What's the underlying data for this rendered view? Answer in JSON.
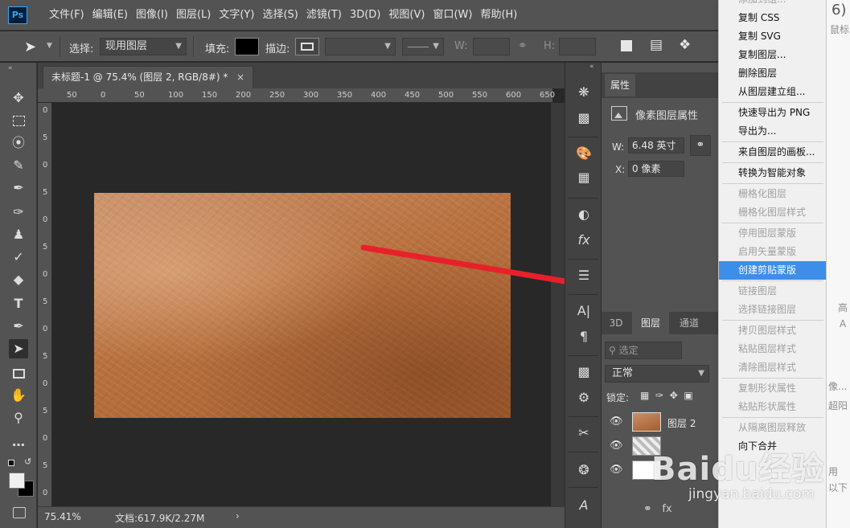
{
  "app": {
    "logo": "Ps"
  },
  "menu": [
    "文件(F)",
    "编辑(E)",
    "图像(I)",
    "图层(L)",
    "文字(Y)",
    "选择(S)",
    "滤镜(T)",
    "3D(D)",
    "视图(V)",
    "窗口(W)",
    "帮助(H)"
  ],
  "options": {
    "select_label": "选择:",
    "select_value": "现用图层",
    "fill_label": "填充:",
    "stroke_label": "描边:",
    "w_label": "W:",
    "h_label": "H:"
  },
  "document": {
    "tab_title": "未标题-1 @ 75.4% (图层 2, RGB/8#) *",
    "ruler_h": [
      "50",
      "0",
      "50",
      "100",
      "150",
      "200",
      "250",
      "300",
      "350",
      "400",
      "450",
      "500",
      "550",
      "600",
      "650"
    ],
    "ruler_v": [
      "0",
      "5",
      "0",
      "5",
      "0",
      "5",
      "0",
      "5",
      "0",
      "5",
      "0",
      "5",
      "0",
      "5",
      "0"
    ]
  },
  "status": {
    "zoom": "75.41%",
    "doc": "文档:617.9K/2.27M",
    "arrow": "›"
  },
  "properties": {
    "tab": "属性",
    "title": "像素图层属性",
    "w_label": "W:",
    "w_value": "6.48 英寸",
    "x_label": "X:",
    "x_value": "0 像素"
  },
  "layers": {
    "tabs": [
      "3D",
      "图层",
      "通道"
    ],
    "filter_placeholder": "选定",
    "blend_mode": "正常",
    "lock_label": "锁定:",
    "rows": [
      {
        "name": "图层 2",
        "visible": true
      },
      {
        "name": "",
        "visible": true
      },
      {
        "name": "",
        "visible": true
      }
    ]
  },
  "context_menu": {
    "items": [
      {
        "label": "添加到组...",
        "state": "dis",
        "sep_after": false
      },
      {
        "label": "复制 CSS",
        "state": "on",
        "sep_after": false
      },
      {
        "label": "复制 SVG",
        "state": "on",
        "sep_after": false
      },
      {
        "label": "复制图层...",
        "state": "on",
        "sep_after": false
      },
      {
        "label": "删除图层",
        "state": "on",
        "sep_after": false
      },
      {
        "label": "从图层建立组...",
        "state": "on",
        "sep_after": true
      },
      {
        "label": "快速导出为 PNG",
        "state": "on",
        "sep_after": false
      },
      {
        "label": "导出为...",
        "state": "on",
        "sep_after": true
      },
      {
        "label": "来自图层的画板...",
        "state": "on",
        "sep_after": true
      },
      {
        "label": "转换为智能对象",
        "state": "on",
        "sep_after": true
      },
      {
        "label": "栅格化图层",
        "state": "dis",
        "sep_after": false
      },
      {
        "label": "栅格化图层样式",
        "state": "dis",
        "sep_after": true
      },
      {
        "label": "停用图层蒙版",
        "state": "dis",
        "sep_after": false
      },
      {
        "label": "启用矢量蒙版",
        "state": "dis",
        "sep_after": false
      },
      {
        "label": "创建剪贴蒙版",
        "state": "hl",
        "sep_after": true
      },
      {
        "label": "链接图层",
        "state": "dis",
        "sep_after": false
      },
      {
        "label": "选择链接图层",
        "state": "dis",
        "sep_after": true
      },
      {
        "label": "拷贝图层样式",
        "state": "dis",
        "sep_after": false
      },
      {
        "label": "粘贴图层样式",
        "state": "dis",
        "sep_after": false
      },
      {
        "label": "清除图层样式",
        "state": "dis",
        "sep_after": true
      },
      {
        "label": "复制形状属性",
        "state": "dis",
        "sep_after": false
      },
      {
        "label": "粘贴形状属性",
        "state": "dis",
        "sep_after": true
      },
      {
        "label": "从隔离图层释放",
        "state": "dis",
        "sep_after": false
      },
      {
        "label": "向下合并",
        "state": "on",
        "sep_after": false
      }
    ]
  },
  "background_page": {
    "lines": [
      "6)",
      "鼠标",
      "高",
      "A",
      "像...",
      "超阳",
      "用",
      "以下"
    ]
  },
  "watermark": {
    "main": "Baidu经验",
    "sub": "jingyan.baidu.com"
  },
  "colors": {
    "accent": "#3d8ee8",
    "arrow": "#e8202a",
    "leather": "#b8703f"
  }
}
